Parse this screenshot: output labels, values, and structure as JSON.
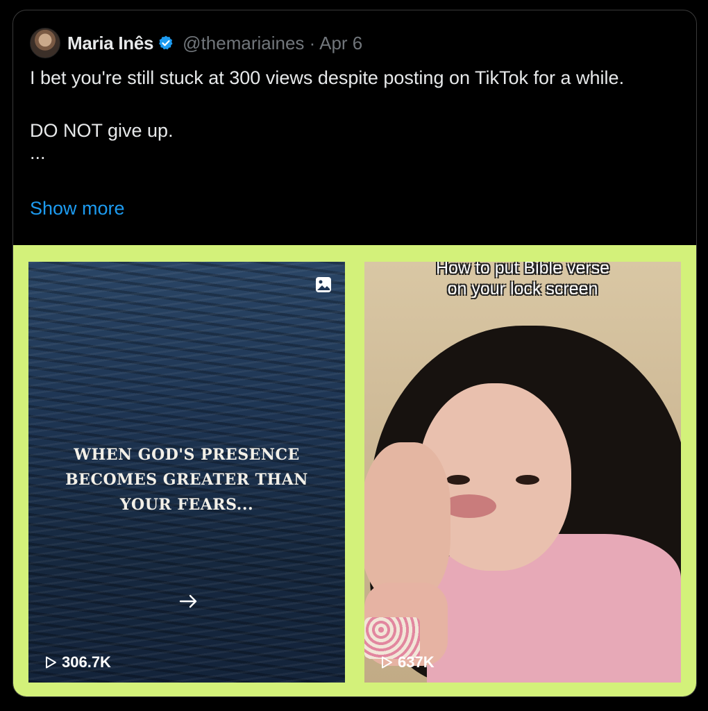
{
  "tweet": {
    "author_name": "Maria Inês",
    "verified": true,
    "handle": "@themariaines",
    "separator": "·",
    "date": "Apr 6",
    "lines": [
      "I bet you're still stuck at 300 views despite posting on TikTok for a while.",
      "DO NOT give up.",
      "..."
    ],
    "show_more_label": "Show more"
  },
  "media": {
    "background_color": "#d3f17a",
    "items": [
      {
        "overlay_text_lines": [
          "WHEN GOD'S PRESENCE",
          "BECOMES GREATER THAN",
          "YOUR FEARS..."
        ],
        "views": "306.7K",
        "icon": "multi-image-icon"
      },
      {
        "caption_lines": [
          "How to put Bible verse",
          "on your lock screen"
        ],
        "views": "637K",
        "icon": "play-icon"
      }
    ]
  },
  "colors": {
    "link": "#1d9bf0",
    "muted": "#71767b",
    "verified_badge": "#1d9bf0"
  }
}
